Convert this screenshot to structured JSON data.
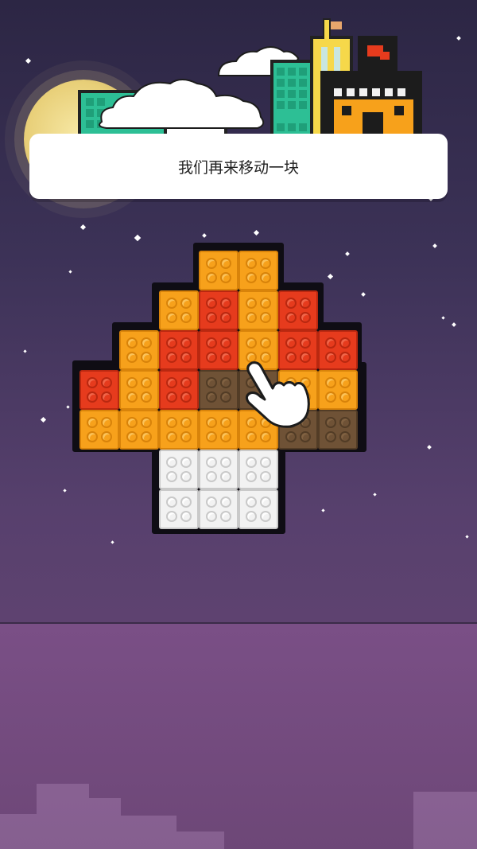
{
  "tutorial": {
    "message": "我们再来移动一块"
  },
  "colors": {
    "orange": "#f7a11b",
    "red": "#e63b1d",
    "white": "#f2f2f2",
    "ghost": "#7a5a3a",
    "teal": "#2dbf95",
    "yellow": "#f6d84a"
  },
  "board": {
    "rows": [
      [
        "_",
        "_",
        "_",
        "O",
        "O",
        "_",
        "_",
        "_"
      ],
      [
        "_",
        "_",
        "O",
        "R",
        "O",
        "R",
        "_",
        "_"
      ],
      [
        "_",
        "O",
        "R",
        "R",
        "O",
        "R",
        "R",
        "_"
      ],
      [
        "R",
        "O",
        "R",
        "G",
        "G",
        "O",
        "O",
        "_"
      ],
      [
        "O",
        "O",
        "O",
        "O",
        "O",
        "G",
        "G",
        "_"
      ],
      [
        "_",
        "_",
        "W",
        "W",
        "W",
        "_",
        "_",
        "_"
      ],
      [
        "_",
        "_",
        "W",
        "W",
        "W",
        "_",
        "_",
        "_"
      ]
    ]
  }
}
